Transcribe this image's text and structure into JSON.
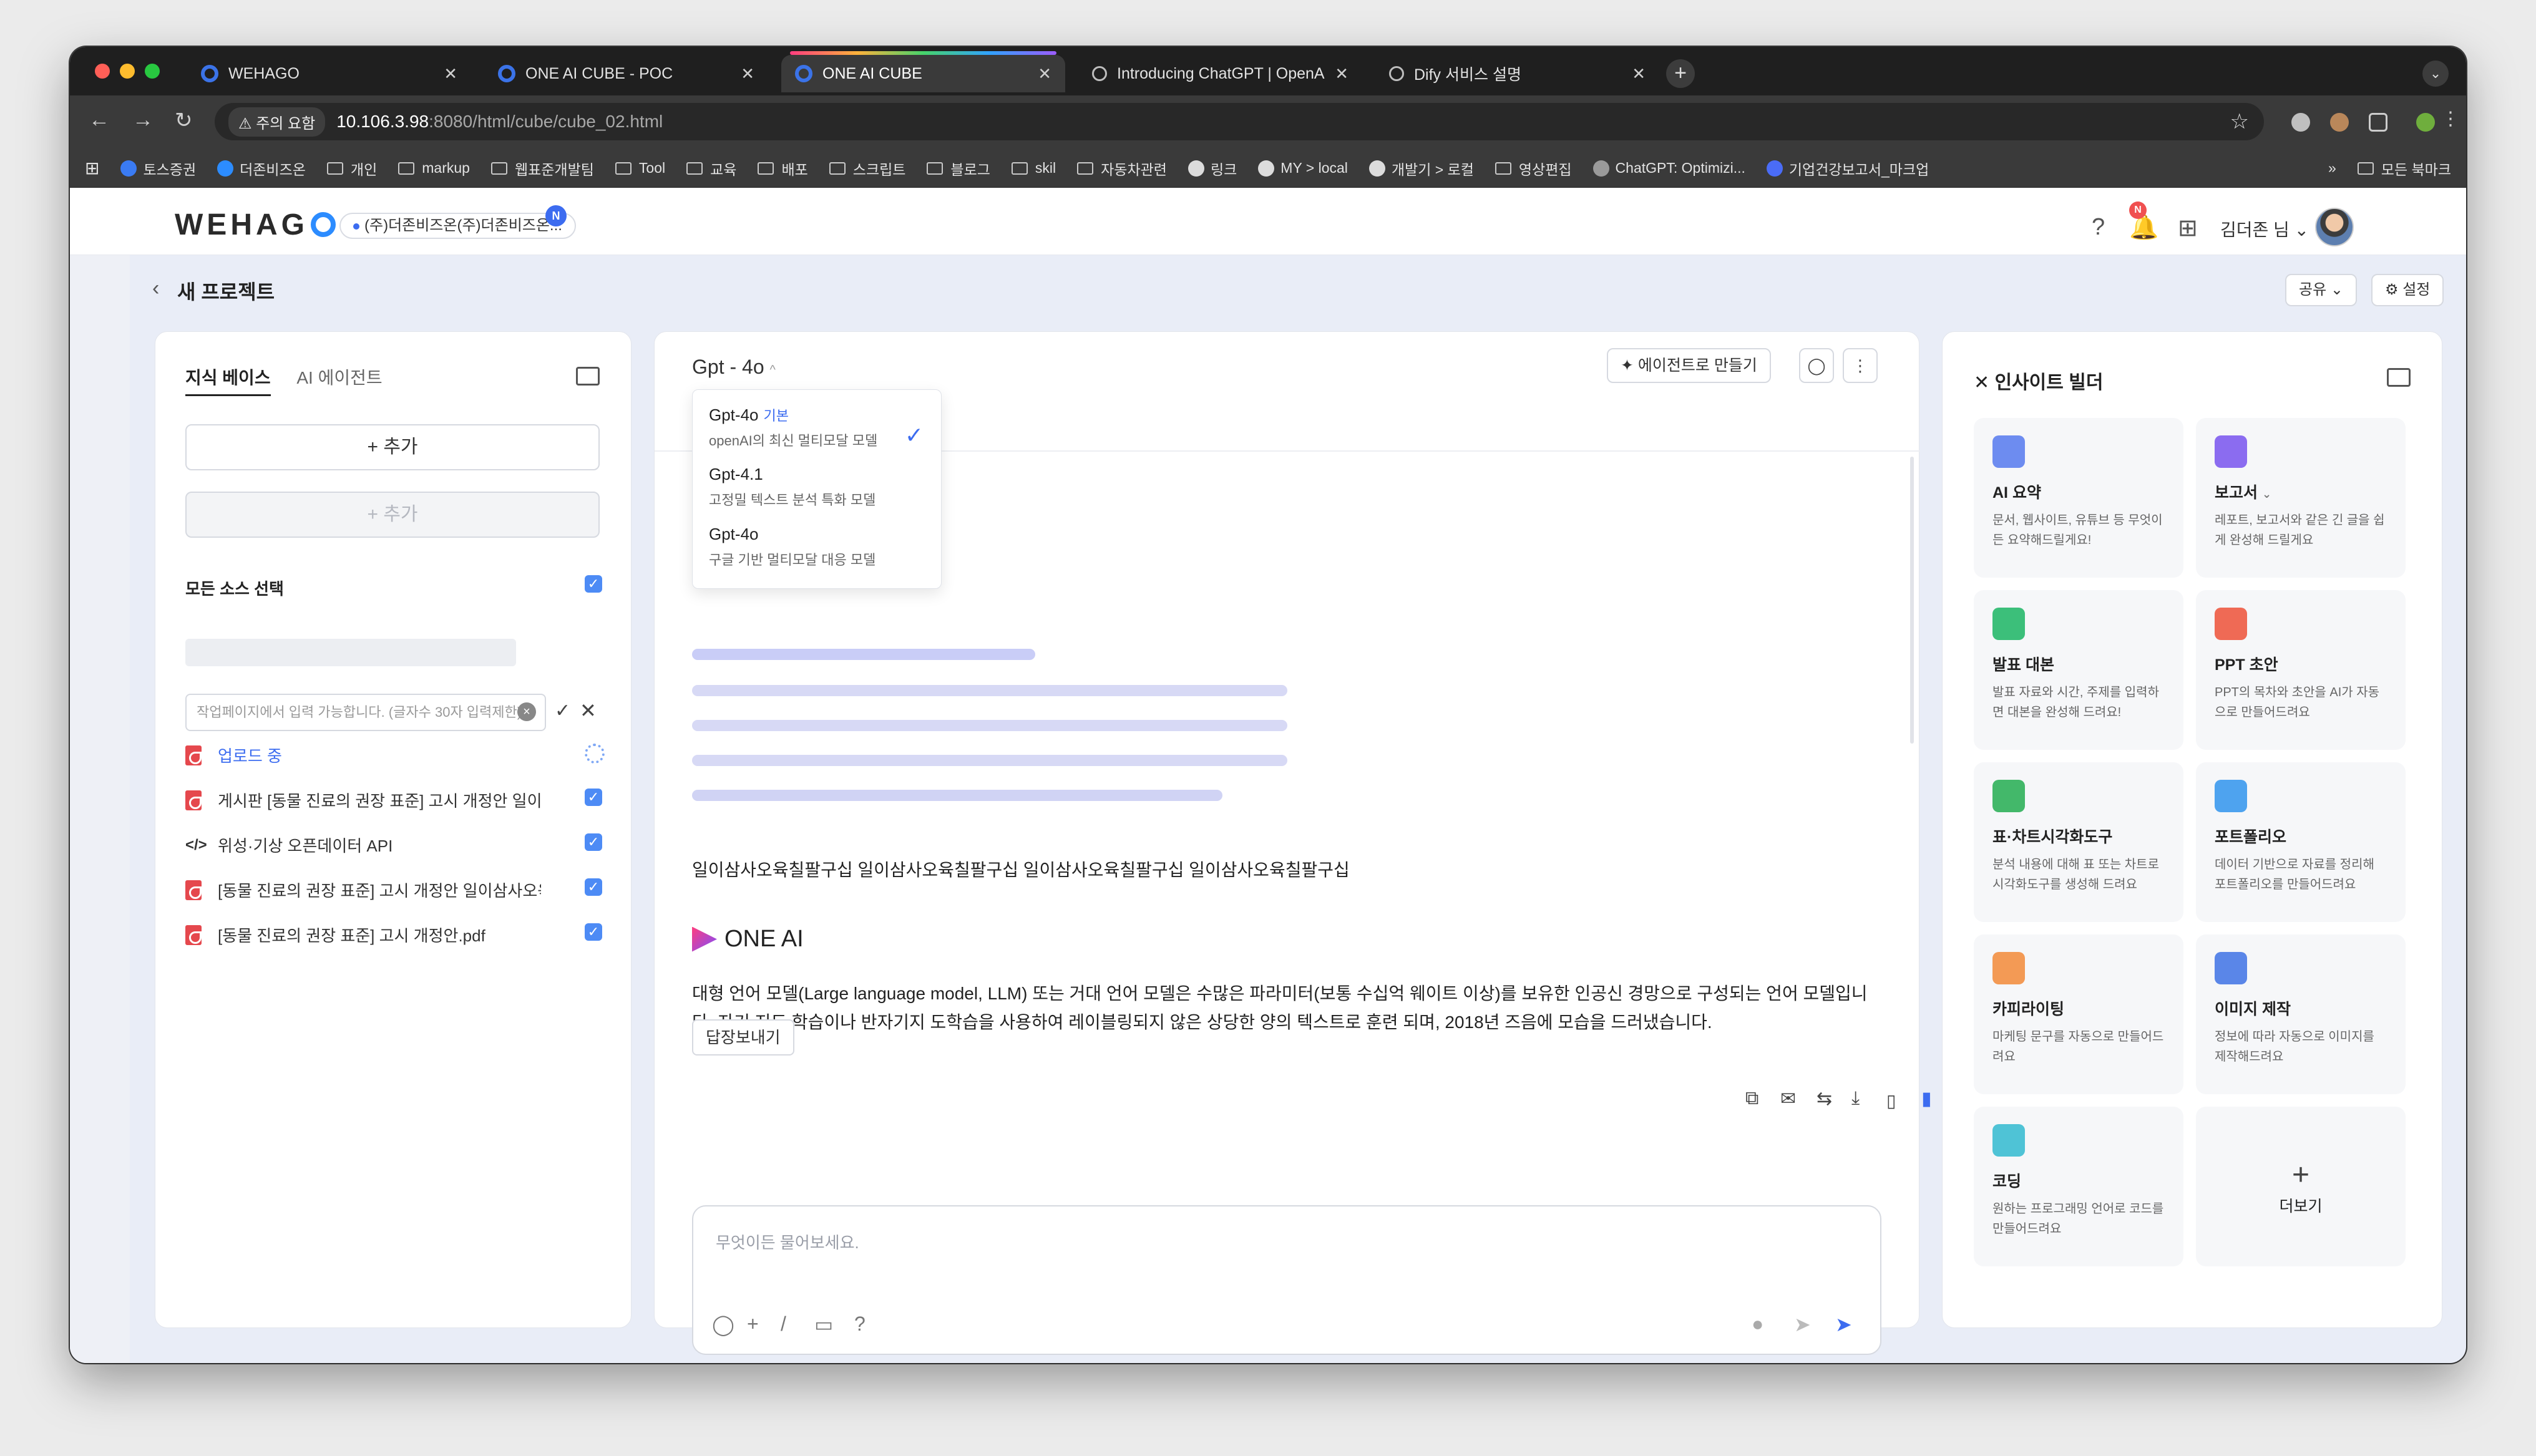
{
  "browser": {
    "tabs": [
      {
        "title": "WEHAGO",
        "active": false
      },
      {
        "title": "ONE AI CUBE - POC",
        "active": false
      },
      {
        "title": "ONE AI CUBE",
        "active": true
      },
      {
        "title": "Introducing ChatGPT | OpenA",
        "active": false
      },
      {
        "title": "Dify 서비스 설명",
        "active": false
      }
    ],
    "warning": "주의 요함",
    "url_host": "10.106.3.98",
    "url_path": ":8080/html/cube/cube_02.html",
    "bookmarks": [
      "토스증권",
      "더존비즈온",
      "개인",
      "markup",
      "웹표준개발팀",
      "Tool",
      "교육",
      "배포",
      "스크립트",
      "블로그",
      "skil",
      "자동차관련",
      "링크",
      "MY > local",
      "개발기 > 로컬",
      "영상편집",
      "ChatGPT: Optimizi...",
      "기업건강보고서_마크업"
    ],
    "bookmarks_all": "모든 북마크"
  },
  "app": {
    "logo": "WEHAG",
    "company": "(주)더존비즈온(주)더존비즈온...",
    "company_badge": "N",
    "bell_badge": "N",
    "user": "김더존 님"
  },
  "page": {
    "title": "새 프로젝트",
    "share": "공유",
    "settings": "설정"
  },
  "knowledge": {
    "tab_kb": "지식 베이스",
    "tab_agent": "AI 에이전트",
    "add1": "+ 추가",
    "add2": "+ 추가",
    "select_all": "모든 소스 선택",
    "input_placeholder": "작업페이지에서 입력 가능합니다. (글자수 30자 입력제한)",
    "items": [
      {
        "label": "업로드 중",
        "uploading": true
      },
      {
        "label": "게시판 [동물 진료의 권장 표준] 고시 개정안 일이삼사오육칠팔구십"
      },
      {
        "label": "위성·기상 오픈데이터 API"
      },
      {
        "label": "[동물 진료의 권장 표준] 고시 개정안 일이삼사오육칠팔구십"
      },
      {
        "label": "[동물 진료의 권장 표준] 고시 개정안.pdf"
      }
    ]
  },
  "chat": {
    "model": "Gpt - 4o",
    "agent_button": "에이전트로 만들기",
    "models": [
      {
        "name": "Gpt-4o",
        "tag": "기본",
        "desc": "openAI의 최신 멀티모달 모델",
        "selected": true
      },
      {
        "name": "Gpt-4.1",
        "tag": "",
        "desc": "고정밀 텍스트 분석 특화 모델",
        "selected": false
      },
      {
        "name": "Gpt-4o",
        "tag": "",
        "desc": "구글 기반 멀티모달 대응 모델",
        "selected": false
      }
    ],
    "user_message": "일이삼사오육칠팔구십 일이삼사오육칠팔구십 일이삼사오육칠팔구십 일이삼사오육칠팔구십",
    "brand": "ONE AI",
    "answer": "대형 언어 모델(Large language model, LLM) 또는 거대 언어 모델은 수많은 파라미터(보통 수십억 웨이트 이상)를 보유한 인공신 경망으로 구성되는 언어 모델입니다. 자기 지도 학습이나 반자기지 도학습을 사용하여 레이블링되지 않은 상당한 양의 텍스트로 훈련 되며, 2018년 즈음에 모습을 드러냈습니다.",
    "reply_button": "답장보내기",
    "placeholder": "무엇이든 물어보세요."
  },
  "insight": {
    "title": "인사이트 빌더",
    "cards": [
      {
        "title": "AI 요약",
        "desc": "문서, 웹사이트, 유튜브 등 무엇이든 요약해드릴게요!",
        "color": "#6d8cf0"
      },
      {
        "title": "보고서",
        "desc": "레포트, 보고서와 같은 긴 글을 쉽게 완성해 드릴게요",
        "color": "#8b6cf0"
      },
      {
        "title": "발표 대본",
        "desc": "발표 자료와 시간, 주제를 입력하 면 대본을 완성해 드려요!",
        "color": "#3cbf7a"
      },
      {
        "title": "PPT 초안",
        "desc": "PPT의 목차와 초안을 AI가 자동으로 만들어드려요",
        "color": "#ef6a55"
      },
      {
        "title": "표·차트시각화도구",
        "desc": "분석 내용에 대해 표 또는 차트로 시각화도구를 생성해 드려요",
        "color": "#43b86a"
      },
      {
        "title": "포트폴리오",
        "desc": "데이터 기반으로 자료를 정리해 포트폴리오를 만들어드려요",
        "color": "#4ea3ef"
      },
      {
        "title": "카피라이팅",
        "desc": "마케팅 문구를 자동으로 만들어드려요",
        "color": "#f39a55"
      },
      {
        "title": "이미지 제작",
        "desc": "정보에 따라 자동으로 이미지를 제작해드려요",
        "color": "#5a86e8"
      },
      {
        "title": "코딩",
        "desc": "원하는 프로그래밍 언어로 코드를 만들어드려요",
        "color": "#4fc3d6"
      }
    ],
    "more": "더보기"
  }
}
